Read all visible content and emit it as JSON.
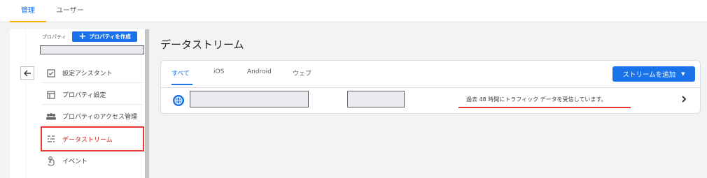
{
  "top_tabs": [
    {
      "label": "管理",
      "active": true
    },
    {
      "label": "ユーザー",
      "active": false
    }
  ],
  "sidebar": {
    "property_label": "プロパティ",
    "create_property_label": "プロパティを作成",
    "items": [
      {
        "label": "設定アシスタント",
        "icon": "checklist-icon"
      },
      {
        "label": "プロパティ設定",
        "icon": "property-settings-icon"
      },
      {
        "label": "プロパティのアクセス管理",
        "icon": "people-icon"
      },
      {
        "label": "データストリーム",
        "icon": "data-streams-icon",
        "highlighted": true
      },
      {
        "label": "イベント",
        "icon": "touch-icon"
      }
    ]
  },
  "main": {
    "title": "データストリーム",
    "tabs": [
      {
        "label": "すべて",
        "active": true
      },
      {
        "label": "iOS",
        "active": false
      },
      {
        "label": "Android",
        "active": false
      },
      {
        "label": "ウェブ",
        "active": false
      }
    ],
    "add_stream_label": "ストリームを追加",
    "stream": {
      "type_icon": "globe-icon",
      "status": "過去 48 時間にトラフィック データを受信しています。"
    }
  },
  "colors": {
    "accent": "#1a73e8",
    "highlight_border": "#e53935",
    "tab_indicator": "#f9ab00"
  }
}
